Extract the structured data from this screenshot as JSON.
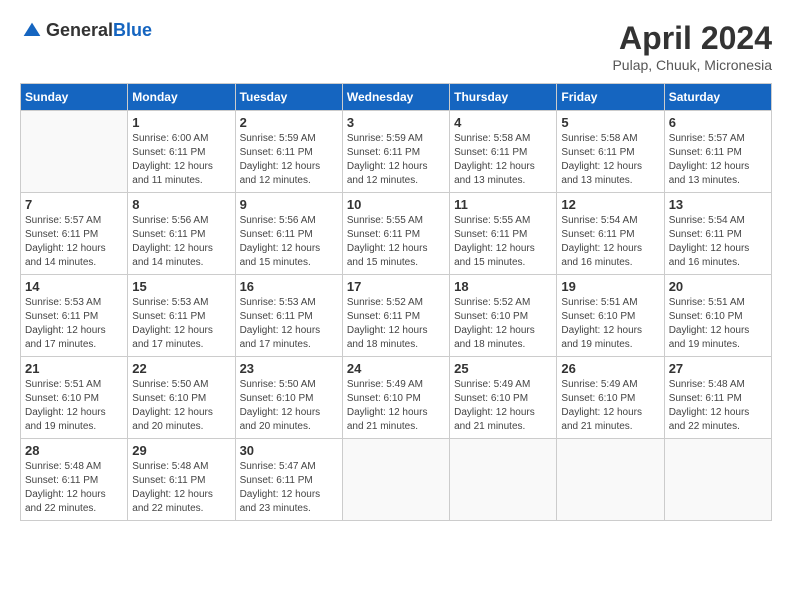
{
  "header": {
    "logo_general": "General",
    "logo_blue": "Blue",
    "month_year": "April 2024",
    "location": "Pulap, Chuuk, Micronesia"
  },
  "weekdays": [
    "Sunday",
    "Monday",
    "Tuesday",
    "Wednesday",
    "Thursday",
    "Friday",
    "Saturday"
  ],
  "weeks": [
    [
      {
        "day": "",
        "info": ""
      },
      {
        "day": "1",
        "info": "Sunrise: 6:00 AM\nSunset: 6:11 PM\nDaylight: 12 hours\nand 11 minutes."
      },
      {
        "day": "2",
        "info": "Sunrise: 5:59 AM\nSunset: 6:11 PM\nDaylight: 12 hours\nand 12 minutes."
      },
      {
        "day": "3",
        "info": "Sunrise: 5:59 AM\nSunset: 6:11 PM\nDaylight: 12 hours\nand 12 minutes."
      },
      {
        "day": "4",
        "info": "Sunrise: 5:58 AM\nSunset: 6:11 PM\nDaylight: 12 hours\nand 13 minutes."
      },
      {
        "day": "5",
        "info": "Sunrise: 5:58 AM\nSunset: 6:11 PM\nDaylight: 12 hours\nand 13 minutes."
      },
      {
        "day": "6",
        "info": "Sunrise: 5:57 AM\nSunset: 6:11 PM\nDaylight: 12 hours\nand 13 minutes."
      }
    ],
    [
      {
        "day": "7",
        "info": "Sunrise: 5:57 AM\nSunset: 6:11 PM\nDaylight: 12 hours\nand 14 minutes."
      },
      {
        "day": "8",
        "info": "Sunrise: 5:56 AM\nSunset: 6:11 PM\nDaylight: 12 hours\nand 14 minutes."
      },
      {
        "day": "9",
        "info": "Sunrise: 5:56 AM\nSunset: 6:11 PM\nDaylight: 12 hours\nand 15 minutes."
      },
      {
        "day": "10",
        "info": "Sunrise: 5:55 AM\nSunset: 6:11 PM\nDaylight: 12 hours\nand 15 minutes."
      },
      {
        "day": "11",
        "info": "Sunrise: 5:55 AM\nSunset: 6:11 PM\nDaylight: 12 hours\nand 15 minutes."
      },
      {
        "day": "12",
        "info": "Sunrise: 5:54 AM\nSunset: 6:11 PM\nDaylight: 12 hours\nand 16 minutes."
      },
      {
        "day": "13",
        "info": "Sunrise: 5:54 AM\nSunset: 6:11 PM\nDaylight: 12 hours\nand 16 minutes."
      }
    ],
    [
      {
        "day": "14",
        "info": "Sunrise: 5:53 AM\nSunset: 6:11 PM\nDaylight: 12 hours\nand 17 minutes."
      },
      {
        "day": "15",
        "info": "Sunrise: 5:53 AM\nSunset: 6:11 PM\nDaylight: 12 hours\nand 17 minutes."
      },
      {
        "day": "16",
        "info": "Sunrise: 5:53 AM\nSunset: 6:11 PM\nDaylight: 12 hours\nand 17 minutes."
      },
      {
        "day": "17",
        "info": "Sunrise: 5:52 AM\nSunset: 6:11 PM\nDaylight: 12 hours\nand 18 minutes."
      },
      {
        "day": "18",
        "info": "Sunrise: 5:52 AM\nSunset: 6:10 PM\nDaylight: 12 hours\nand 18 minutes."
      },
      {
        "day": "19",
        "info": "Sunrise: 5:51 AM\nSunset: 6:10 PM\nDaylight: 12 hours\nand 19 minutes."
      },
      {
        "day": "20",
        "info": "Sunrise: 5:51 AM\nSunset: 6:10 PM\nDaylight: 12 hours\nand 19 minutes."
      }
    ],
    [
      {
        "day": "21",
        "info": "Sunrise: 5:51 AM\nSunset: 6:10 PM\nDaylight: 12 hours\nand 19 minutes."
      },
      {
        "day": "22",
        "info": "Sunrise: 5:50 AM\nSunset: 6:10 PM\nDaylight: 12 hours\nand 20 minutes."
      },
      {
        "day": "23",
        "info": "Sunrise: 5:50 AM\nSunset: 6:10 PM\nDaylight: 12 hours\nand 20 minutes."
      },
      {
        "day": "24",
        "info": "Sunrise: 5:49 AM\nSunset: 6:10 PM\nDaylight: 12 hours\nand 21 minutes."
      },
      {
        "day": "25",
        "info": "Sunrise: 5:49 AM\nSunset: 6:10 PM\nDaylight: 12 hours\nand 21 minutes."
      },
      {
        "day": "26",
        "info": "Sunrise: 5:49 AM\nSunset: 6:10 PM\nDaylight: 12 hours\nand 21 minutes."
      },
      {
        "day": "27",
        "info": "Sunrise: 5:48 AM\nSunset: 6:11 PM\nDaylight: 12 hours\nand 22 minutes."
      }
    ],
    [
      {
        "day": "28",
        "info": "Sunrise: 5:48 AM\nSunset: 6:11 PM\nDaylight: 12 hours\nand 22 minutes."
      },
      {
        "day": "29",
        "info": "Sunrise: 5:48 AM\nSunset: 6:11 PM\nDaylight: 12 hours\nand 22 minutes."
      },
      {
        "day": "30",
        "info": "Sunrise: 5:47 AM\nSunset: 6:11 PM\nDaylight: 12 hours\nand 23 minutes."
      },
      {
        "day": "",
        "info": ""
      },
      {
        "day": "",
        "info": ""
      },
      {
        "day": "",
        "info": ""
      },
      {
        "day": "",
        "info": ""
      }
    ]
  ]
}
